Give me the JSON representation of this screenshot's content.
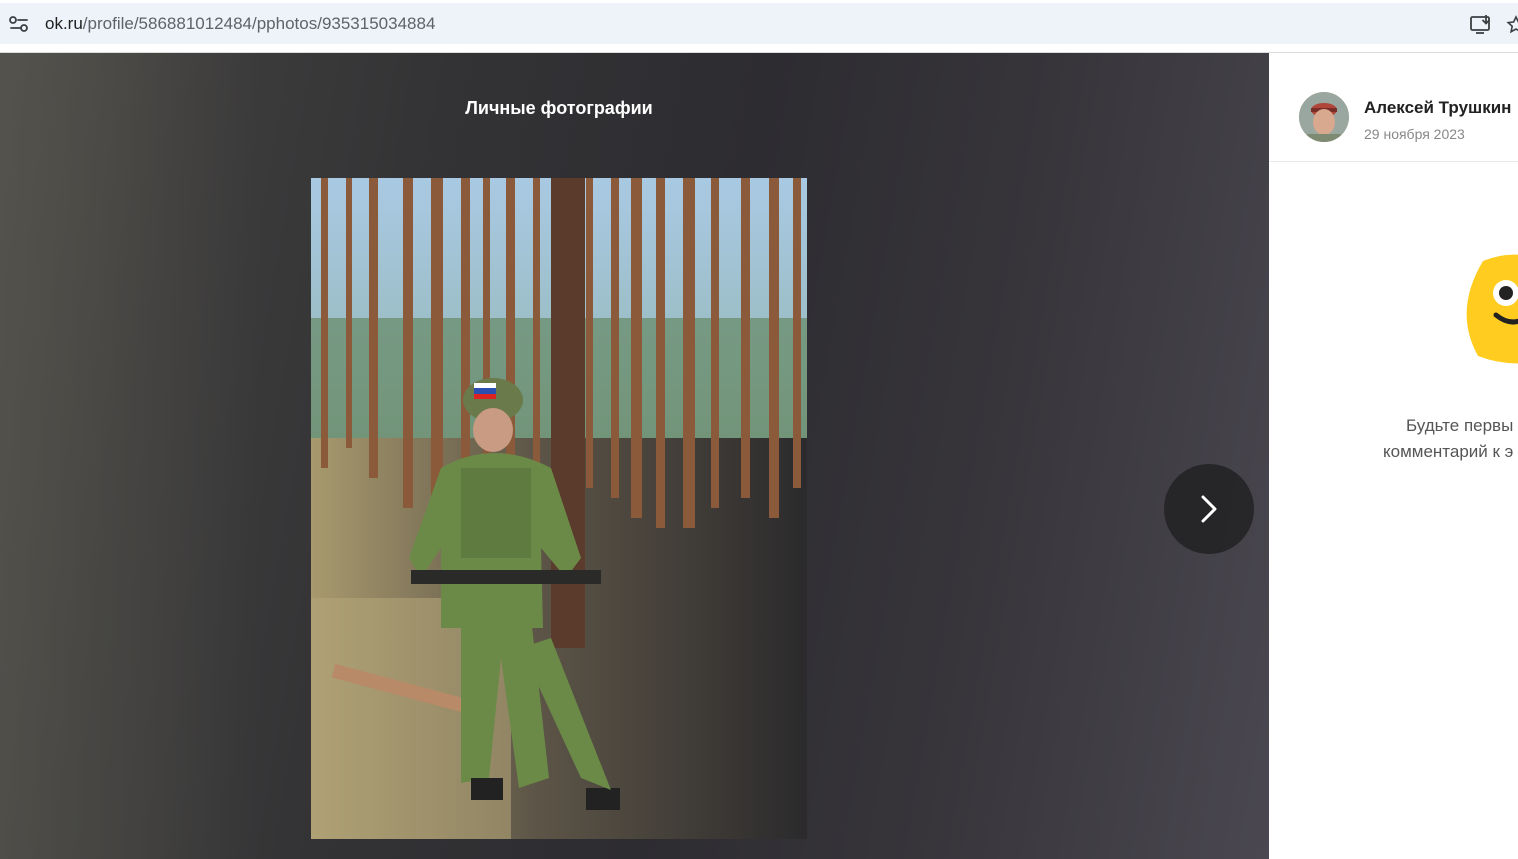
{
  "browser": {
    "url_host": "ok.ru",
    "url_path": "/profile/586881012484/pphotos/935315034884"
  },
  "viewer": {
    "album_title": "Личные фотографии",
    "next_icon": "chevron-right-icon"
  },
  "sidebar": {
    "author_name": "Алексей Трушкин",
    "post_date": "29 ноября 2023",
    "comment_hint_line1": "Будьте первы",
    "comment_hint_line2": "комментарий к э"
  },
  "colors": {
    "viewer_bg": "#333335",
    "mascot_yellow": "#ffcc1f"
  }
}
